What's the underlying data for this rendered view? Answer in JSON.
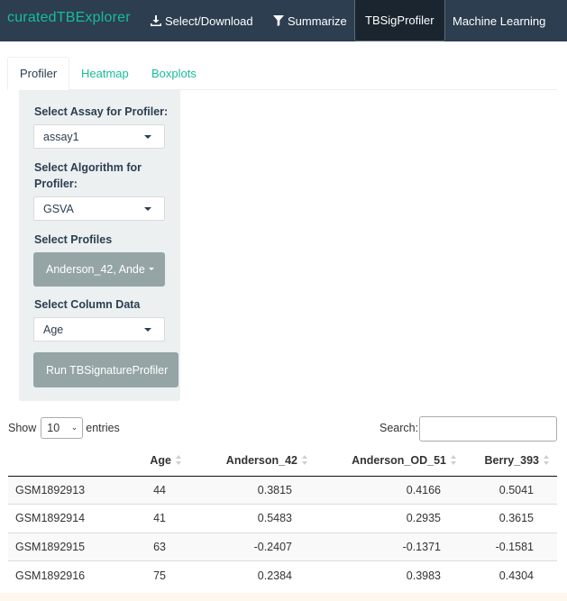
{
  "app": {
    "brand": "curatedTBExplorer"
  },
  "nav": {
    "items": [
      {
        "label": "Select/Download",
        "icon": "download-icon"
      },
      {
        "label": "Summarize",
        "icon": "filter-icon"
      },
      {
        "label": "TBSigProfiler",
        "active": true
      },
      {
        "label": "Machine Learning"
      }
    ]
  },
  "tabs": [
    {
      "label": "Profiler",
      "active": true
    },
    {
      "label": "Heatmap"
    },
    {
      "label": "Boxplots"
    }
  ],
  "sidebar": {
    "assay_label": "Select Assay for Profiler:",
    "assay_value": "assay1",
    "algorithm_label_line1": "Select Algorithm for",
    "algorithm_label_line2": "Profiler:",
    "algorithm_value": "GSVA",
    "profiles_label": "Select Profiles",
    "profiles_value": "Anderson_42, Ande",
    "column_label": "Select Column Data",
    "column_value": "Age",
    "run_button": "Run TBSignatureProfiler"
  },
  "table_controls": {
    "show_label": "Show",
    "page_length": "10",
    "entries_label": "entries",
    "search_label": "Search:",
    "search_value": ""
  },
  "table": {
    "columns": [
      "",
      "Age",
      "Anderson_42",
      "Anderson_OD_51",
      "Berry_393"
    ],
    "rows": [
      [
        "GSM1892913",
        "44",
        "0.3815",
        "0.4166",
        "0.5041"
      ],
      [
        "GSM1892914",
        "41",
        "0.5483",
        "0.2935",
        "0.3615"
      ],
      [
        "GSM1892915",
        "63",
        "-0.2407",
        "-0.1371",
        "-0.1581"
      ],
      [
        "GSM1892916",
        "75",
        "0.2384",
        "0.3983",
        "0.4304"
      ]
    ]
  },
  "colors": {
    "navbar": "#2c3e50",
    "brand": "#18bc9c",
    "well": "#ecf0f1",
    "button_gray": "#95a5a6"
  }
}
